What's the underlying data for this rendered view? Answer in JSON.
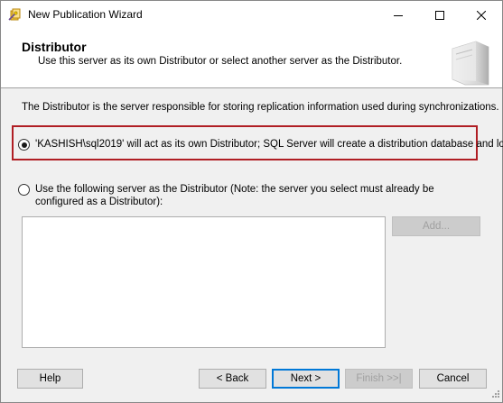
{
  "window": {
    "title": "New Publication Wizard",
    "icons": {
      "app": "publication-wizard-icon",
      "minimize": "minimize-icon",
      "maximize": "maximize-icon",
      "close": "close-icon"
    }
  },
  "header": {
    "title": "Distributor",
    "subtitle": "Use this server as its own Distributor or select another server as the Distributor.",
    "graphic_icon": "server-tower-icon"
  },
  "description": "The Distributor is the server responsible for storing replication information used during synchronizations.",
  "options": {
    "own_distributor": {
      "label": "'KASHISH\\sql2019' will act as its own Distributor; SQL Server will create a distribution database and log",
      "selected": true
    },
    "other_server": {
      "label": "Use the following server as the Distributor (Note: the server you select must already be configured as a Distributor):",
      "selected": false
    }
  },
  "server_list": [],
  "buttons": {
    "add": "Add...",
    "help": "Help",
    "back": "< Back",
    "next": "Next >",
    "finish": "Finish >>|",
    "cancel": "Cancel"
  },
  "colors": {
    "highlight_border": "#b01e24",
    "default_button_border": "#0078d7"
  }
}
